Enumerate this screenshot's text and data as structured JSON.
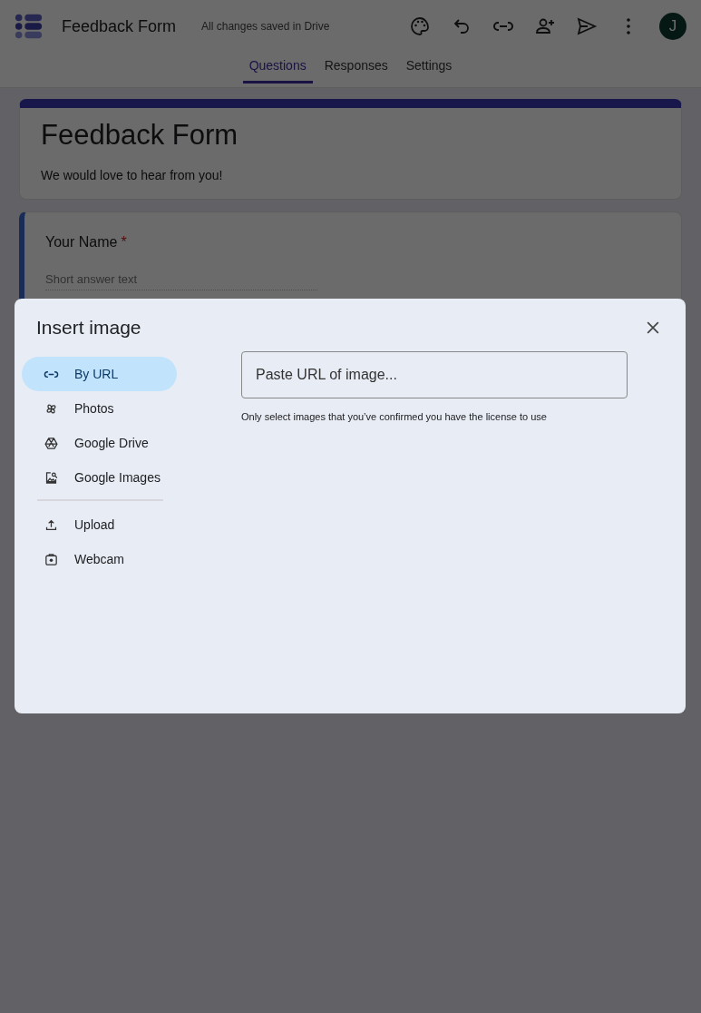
{
  "header": {
    "title": "Feedback Form",
    "save_status": "All changes saved in Drive",
    "avatar": "J"
  },
  "tabs": [
    {
      "label": "Questions",
      "selected": true
    },
    {
      "label": "Responses",
      "selected": false
    },
    {
      "label": "Settings",
      "selected": false
    }
  ],
  "form": {
    "title": "Feedback Form",
    "description": "We would love to hear from you!"
  },
  "question": {
    "label": "Your Name",
    "required_mark": "*",
    "placeholder": "Short answer text"
  },
  "dialog": {
    "title": "Insert image",
    "sources": [
      {
        "label": "By URL",
        "selected": true
      },
      {
        "label": "Photos",
        "selected": false
      },
      {
        "label": "Google Drive",
        "selected": false
      },
      {
        "label": "Google Images",
        "selected": false
      },
      {
        "label": "Upload",
        "selected": false
      },
      {
        "label": "Webcam",
        "selected": false
      }
    ],
    "url_placeholder": "Paste URL of image...",
    "note": "Only select images that you’ve confirmed you have the license to use"
  }
}
